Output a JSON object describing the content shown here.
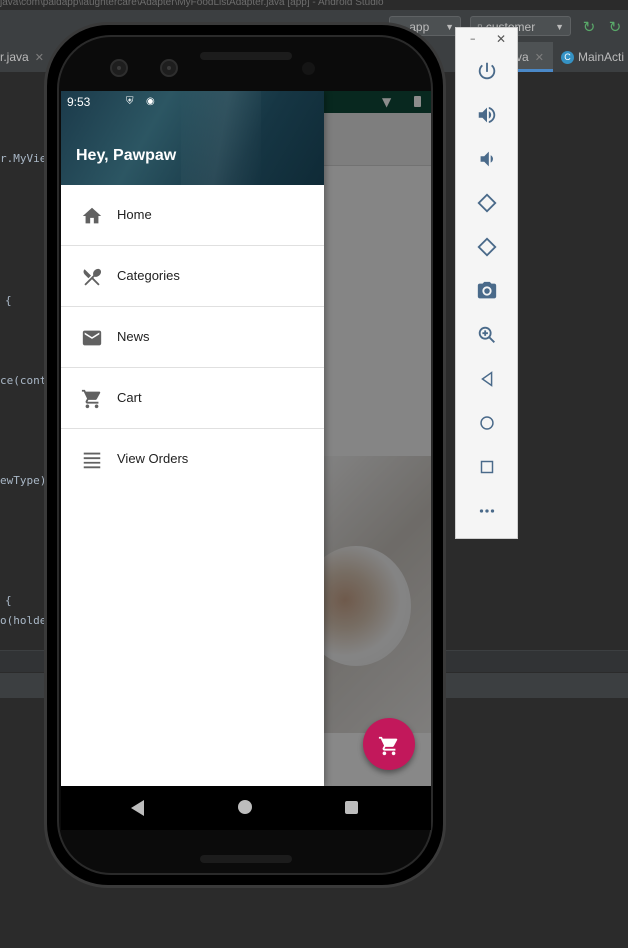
{
  "ide": {
    "path_text": "java\\com\\paldapp\\laughtercare\\Adapter\\MyFoodListAdapter.java [app] - Android Studio",
    "toolbar": {
      "config_label": "app",
      "device_label": "customer"
    },
    "tabs": [
      {
        "label": "r.java",
        "closable": true
      },
      {
        "label": "va",
        "closable": true
      },
      {
        "label": "MainActi",
        "closable": false
      }
    ],
    "code_lines": [
      {
        "text": "r.MyVie"
      },
      {
        "text": "{"
      },
      {
        "text": "ce(cont"
      },
      {
        "text": "ewType)"
      },
      {
        "text": "{"
      },
      {
        "text": "o(holde"
      }
    ]
  },
  "phone": {
    "status_time": "9:53",
    "drawer": {
      "header_title": "Hey, Pawpaw",
      "items": [
        {
          "label": "Home",
          "icon": "home-icon"
        },
        {
          "label": "Categories",
          "icon": "restaurant-icon"
        },
        {
          "label": "News",
          "icon": "mail-icon"
        },
        {
          "label": "Cart",
          "icon": "cart-icon"
        },
        {
          "label": "View Orders",
          "icon": "list-icon"
        }
      ]
    },
    "fab_icon": "cart-icon"
  },
  "emulator_panel": {
    "buttons": [
      "power-icon",
      "volume-up-icon",
      "volume-down-icon",
      "rotate-left-icon",
      "rotate-right-icon",
      "camera-icon",
      "zoom-icon",
      "back-icon",
      "home-icon",
      "overview-icon",
      "more-icon"
    ]
  },
  "colors": {
    "drawer_header": "#1b3a4a",
    "fab": "#c2185b",
    "ide_bg": "#2b2b2b"
  }
}
